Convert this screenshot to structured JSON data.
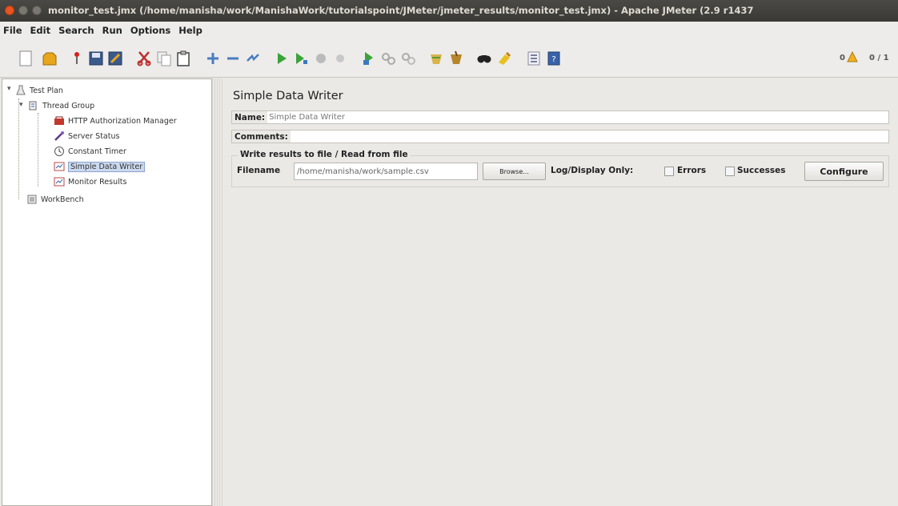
{
  "window": {
    "title": "monitor_test.jmx (/home/manisha/work/ManishaWork/tutorialspoint/JMeter/jmeter_results/monitor_test.jmx) - Apache JMeter (2.9 r1437"
  },
  "menu": [
    {
      "label": "File"
    },
    {
      "label": "Edit"
    },
    {
      "label": "Search"
    },
    {
      "label": "Run"
    },
    {
      "label": "Options"
    },
    {
      "label": "Help"
    }
  ],
  "toolbar": {
    "icons": [
      "new-icon",
      "templates-icon",
      "open-icon",
      "save-icon",
      "save-as-icon",
      "cut-icon",
      "copy-icon",
      "paste-icon",
      "expand-icon",
      "collapse-icon",
      "toggle-icon",
      "start-icon",
      "start-no-pauses-icon",
      "stop-icon",
      "shutdown-icon",
      "remote-start-icon",
      "remote-stop-icon",
      "remote-shutdown-icon",
      "clear-icon",
      "clear-all-icon",
      "search-icon",
      "reset-search-icon",
      "function-helper-icon",
      "help-icon"
    ],
    "warning_count": "0",
    "thread_count": "0 / 1"
  },
  "tree": {
    "test_plan": "Test Plan",
    "thread_group": "Thread Group",
    "children": [
      {
        "label": "HTTP Authorization Manager",
        "icon": "auth-manager-icon"
      },
      {
        "label": "Server Status",
        "icon": "sampler-pen-icon"
      },
      {
        "label": "Constant Timer",
        "icon": "timer-icon"
      },
      {
        "label": "Simple Data Writer",
        "icon": "listener-icon",
        "selected": true
      },
      {
        "label": "Monitor Results",
        "icon": "listener-icon"
      }
    ],
    "workbench": "WorkBench"
  },
  "editor": {
    "title": "Simple Data Writer",
    "name_label": "Name:",
    "name_value": "Simple Data Writer",
    "comments_label": "Comments:",
    "comments_value": "",
    "file_group_title": "Write results to file / Read from file",
    "filename_label": "Filename",
    "filename_value": "/home/manisha/work/sample.csv",
    "browse_label": "Browse...",
    "log_display_label": "Log/Display Only:",
    "errors_label": "Errors",
    "successes_label": "Successes",
    "configure_label": "Configure"
  },
  "colors": {
    "accent_close": "#e95420",
    "selection": "#cbd9ef"
  }
}
